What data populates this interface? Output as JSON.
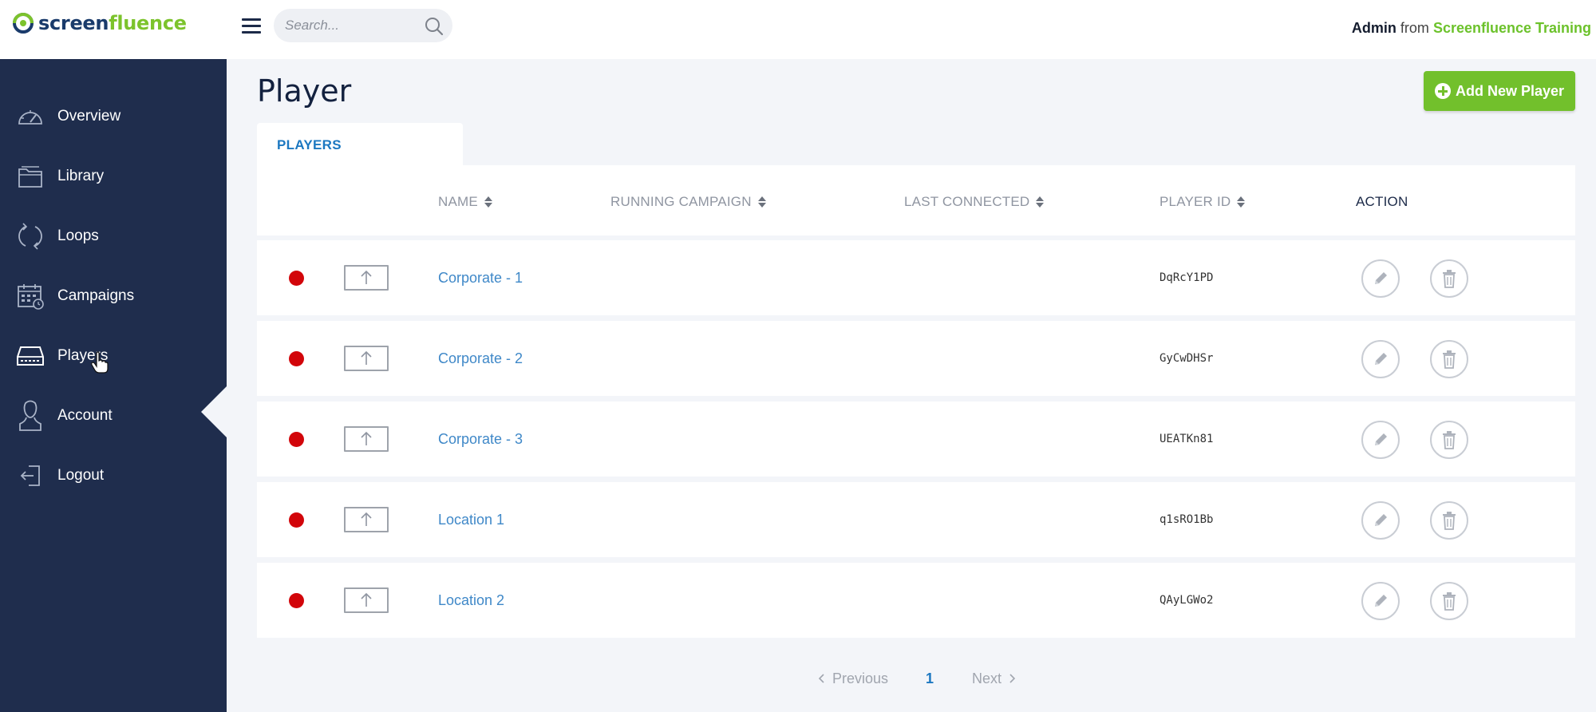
{
  "brand": {
    "part1": "screen",
    "part2": "fluence",
    "green": "#7cc32c",
    "navy": "#1a3b6b"
  },
  "header": {
    "search_placeholder": "Search...",
    "user_name": "Admin",
    "user_from": "from",
    "organization": "Screenfluence Training"
  },
  "sidebar": {
    "active_item": "Players",
    "items": [
      {
        "label": "Overview",
        "icon": "speedometer-icon"
      },
      {
        "label": "Library",
        "icon": "folder-icon"
      },
      {
        "label": "Loops",
        "icon": "loop-icon"
      },
      {
        "label": "Campaigns",
        "icon": "calendar-icon"
      },
      {
        "label": "Players",
        "icon": "player-device-icon"
      },
      {
        "label": "Account",
        "icon": "user-icon"
      },
      {
        "label": "Logout",
        "icon": "logout-icon"
      }
    ]
  },
  "page": {
    "title": "Player",
    "add_button_label": "Add New Player",
    "tab_label": "PLAYERS"
  },
  "table": {
    "columns": {
      "name": "NAME",
      "running_campaign": "RUNNING CAMPAIGN",
      "last_connected": "LAST CONNECTED",
      "player_id": "PLAYER ID",
      "action": "ACTION"
    },
    "rows": [
      {
        "name": "Corporate - 1",
        "running_campaign": "",
        "last_connected": "",
        "player_id": "DqRcY1PD",
        "status": "offline"
      },
      {
        "name": "Corporate - 2",
        "running_campaign": "",
        "last_connected": "",
        "player_id": "GyCwDHSr",
        "status": "offline"
      },
      {
        "name": "Corporate - 3",
        "running_campaign": "",
        "last_connected": "",
        "player_id": "UEATKn81",
        "status": "offline"
      },
      {
        "name": "Location 1",
        "running_campaign": "",
        "last_connected": "",
        "player_id": "q1sRO1Bb",
        "status": "offline"
      },
      {
        "name": "Location 2",
        "running_campaign": "",
        "last_connected": "",
        "player_id": "QAyLGWo2",
        "status": "offline"
      }
    ]
  },
  "pagination": {
    "previous": "Previous",
    "current_page": "1",
    "next": "Next"
  },
  "colors": {
    "sidebar_bg": "#1f2d4d",
    "accent_green": "#72c02c",
    "link_blue": "#3f88c8",
    "status_offline": "#d2050a",
    "page_bg": "#f3f5f9"
  }
}
